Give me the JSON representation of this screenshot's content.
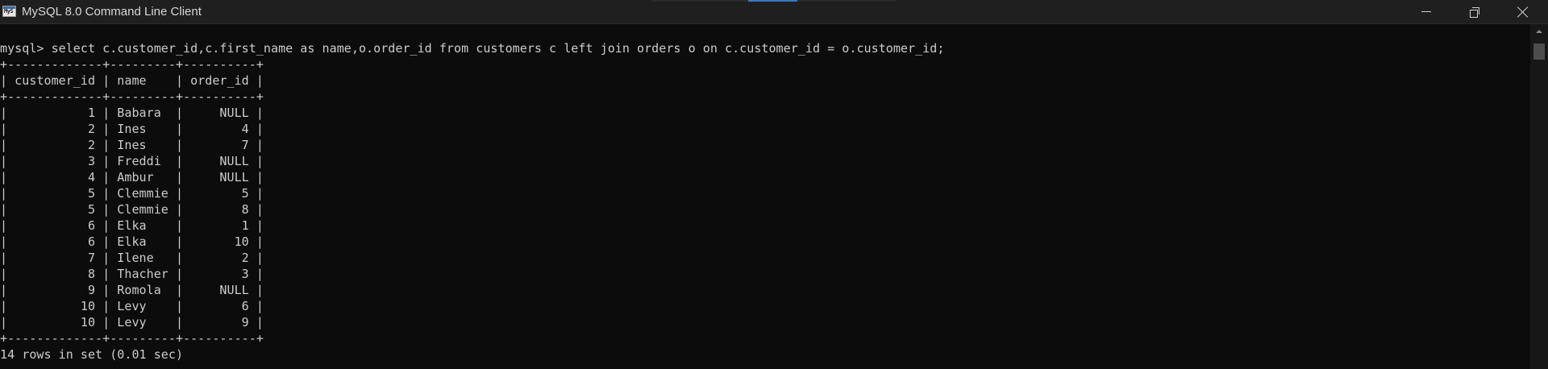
{
  "window": {
    "title": "MySQL 8.0 Command Line Client",
    "icon_name": "mysql-console-icon",
    "icon_glyph": "MyS"
  },
  "controls": {
    "minimize_icon": "minimize-icon",
    "maximize_icon": "restore-icon",
    "close_icon": "close-icon"
  },
  "console": {
    "prompt_line": "mysql> select c.customer_id,c.first_name as name,o.order_id from customers c left join orders o on c.customer_id = o.customer_id;",
    "border_line": "+-------------+---------+----------+",
    "header_line": "| customer_id | name    | order_id |",
    "rows": [
      "|           1 | Babara  |     NULL |",
      "|           2 | Ines    |        4 |",
      "|           2 | Ines    |        7 |",
      "|           3 | Freddi  |     NULL |",
      "|           4 | Ambur   |     NULL |",
      "|           5 | Clemmie |        5 |",
      "|           5 | Clemmie |        8 |",
      "|           6 | Elka    |        1 |",
      "|           6 | Elka    |       10 |",
      "|           7 | Ilene   |        2 |",
      "|           8 | Thacher |        3 |",
      "|           9 | Romola  |     NULL |",
      "|          10 | Levy    |        6 |",
      "|          10 | Levy    |        9 |"
    ],
    "result_summary": "14 rows in set (0.01 sec)"
  },
  "colors": {
    "background": "#0c0c0c",
    "text": "#cccccc",
    "titlebar": "#1f1f1f",
    "accent": "#3a78c4"
  }
}
